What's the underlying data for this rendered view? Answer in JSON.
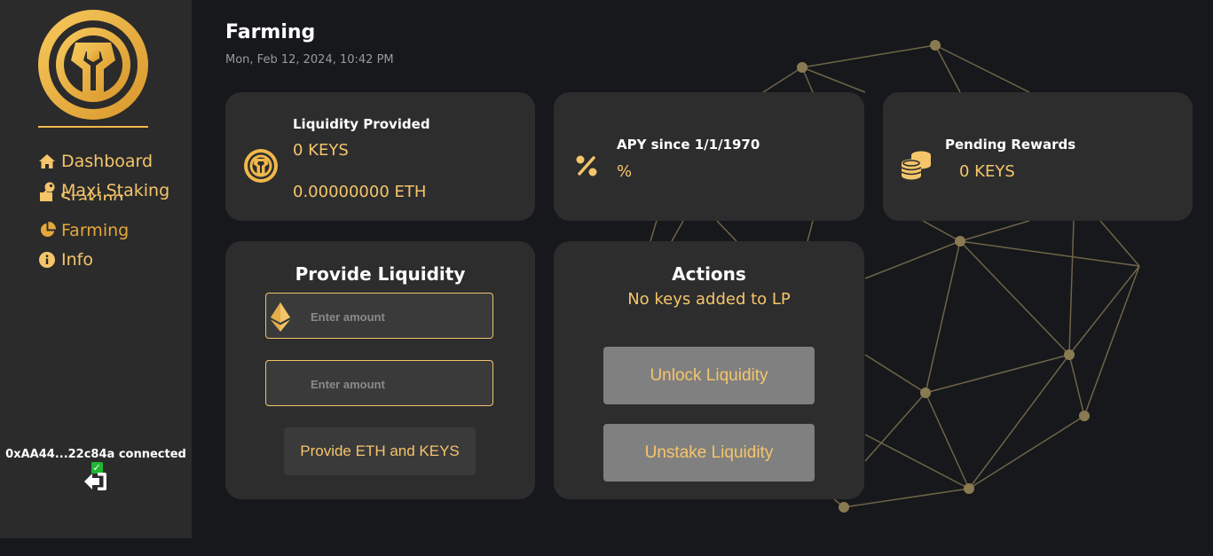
{
  "sidebar": {
    "items": [
      {
        "label": "Dashboard",
        "icon": "home-icon"
      },
      {
        "label": "Maxi Staking",
        "icon": "key-icon",
        "overflow": "Staking"
      },
      {
        "label": "Farming",
        "icon": "pie-chart-icon"
      },
      {
        "label": "Info",
        "icon": "info-icon"
      }
    ],
    "wallet": "0xAA44...22c84a connected",
    "wallet_check": "✓"
  },
  "header": {
    "title": "Farming",
    "date": "Mon, Feb 12, 2024, 10:42 PM"
  },
  "stats": {
    "liquidity": {
      "label": "Liquidity Provided",
      "keys": "0 KEYS",
      "eth": "0.00000000 ETH"
    },
    "apy": {
      "label": "APY since 1/1/1970",
      "value": "%"
    },
    "rewards": {
      "label": "Pending Rewards",
      "value": "0 KEYS"
    }
  },
  "provide": {
    "title": "Provide Liquidity",
    "eth_placeholder": "Enter amount",
    "keys_placeholder": "Enter amount",
    "button": "Provide ETH and KEYS"
  },
  "actions": {
    "title": "Actions",
    "status": "No keys added to LP",
    "unlock": "Unlock Liquidity",
    "unstake": "Unstake Liquidity"
  },
  "colors": {
    "accent": "#f5c56a",
    "background": "#16181b",
    "card": "#2d2d2e",
    "sidebar": "#2b2b2b",
    "button_grey": "#808080"
  }
}
